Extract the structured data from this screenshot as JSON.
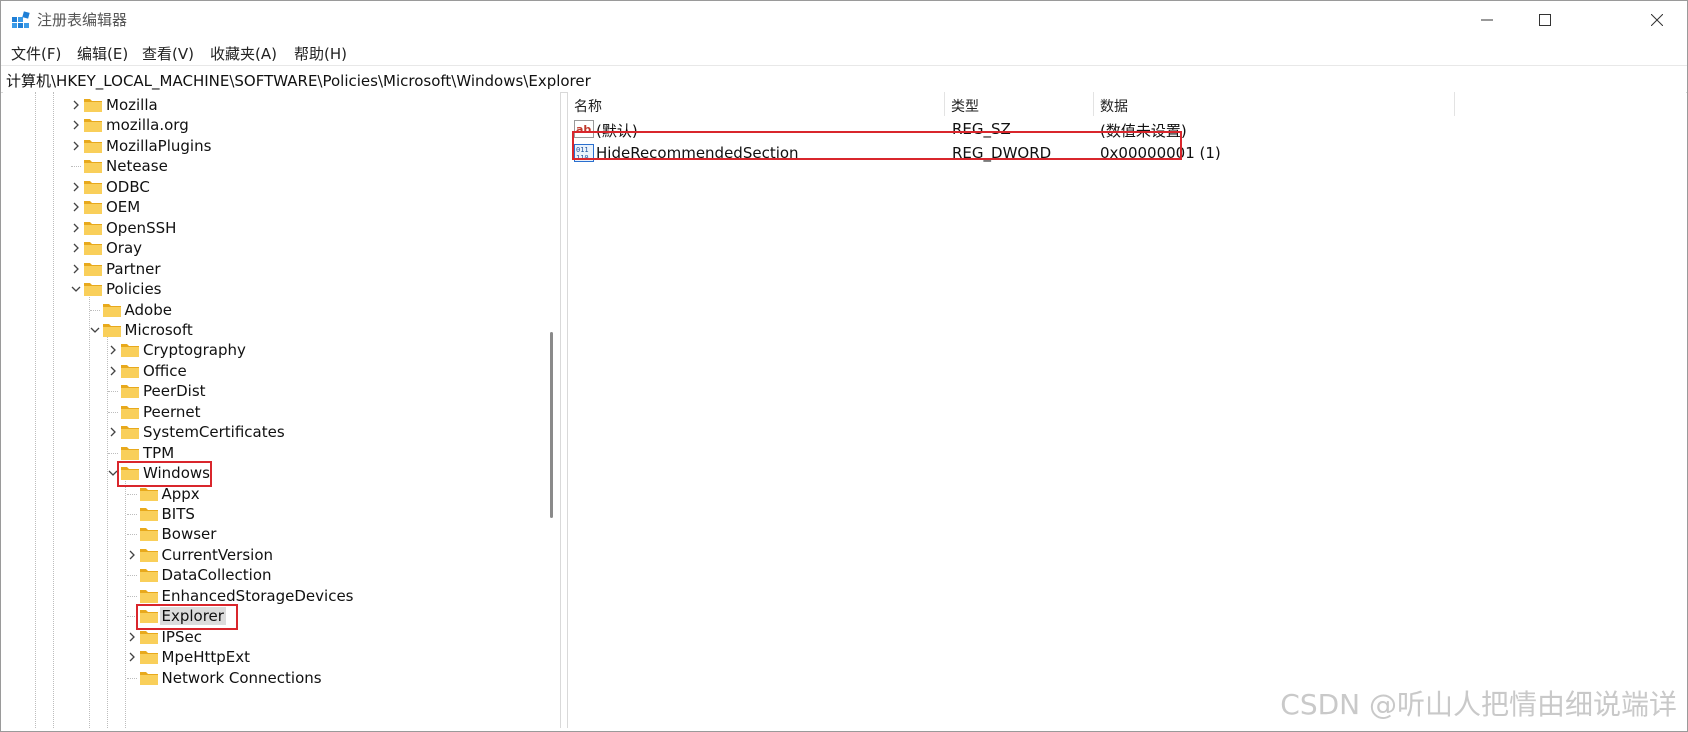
{
  "window": {
    "title": "注册表编辑器",
    "controls": {
      "minimize": "minimize",
      "maximize": "maximize",
      "close": "close"
    }
  },
  "menu": [
    "文件(F)",
    "编辑(E)",
    "查看(V)",
    "收藏夹(A)",
    "帮助(H)"
  ],
  "address": "计算机\\HKEY_LOCAL_MACHINE\\SOFTWARE\\Policies\\Microsoft\\Windows\\Explorer",
  "tree": [
    {
      "label": "Mozilla",
      "expander": "collapsed"
    },
    {
      "label": "mozilla.org",
      "expander": "collapsed"
    },
    {
      "label": "MozillaPlugins",
      "expander": "collapsed"
    },
    {
      "label": "Netease",
      "expander": "none"
    },
    {
      "label": "ODBC",
      "expander": "collapsed"
    },
    {
      "label": "OEM",
      "expander": "collapsed"
    },
    {
      "label": "OpenSSH",
      "expander": "collapsed"
    },
    {
      "label": "Oray",
      "expander": "collapsed"
    },
    {
      "label": "Partner",
      "expander": "collapsed"
    },
    {
      "label": "Policies",
      "expander": "expanded"
    },
    {
      "label": "Adobe",
      "expander": "none"
    },
    {
      "label": "Microsoft",
      "expander": "expanded"
    },
    {
      "label": "Cryptography",
      "expander": "collapsed"
    },
    {
      "label": "Office",
      "expander": "collapsed"
    },
    {
      "label": "PeerDist",
      "expander": "none"
    },
    {
      "label": "Peernet",
      "expander": "none"
    },
    {
      "label": "SystemCertificates",
      "expander": "collapsed"
    },
    {
      "label": "TPM",
      "expander": "none"
    },
    {
      "label": "Windows",
      "expander": "expanded"
    },
    {
      "label": "Appx",
      "expander": "none"
    },
    {
      "label": "BITS",
      "expander": "none"
    },
    {
      "label": "Bowser",
      "expander": "none"
    },
    {
      "label": "CurrentVersion",
      "expander": "collapsed"
    },
    {
      "label": "DataCollection",
      "expander": "none"
    },
    {
      "label": "EnhancedStorageDevices",
      "expander": "none"
    },
    {
      "label": "Explorer",
      "expander": "none",
      "selected": true
    },
    {
      "label": "IPSec",
      "expander": "collapsed"
    },
    {
      "label": "MpeHttpExt",
      "expander": "collapsed"
    },
    {
      "label": "Network Connections",
      "expander": "none"
    }
  ],
  "list": {
    "columns": [
      "名称",
      "类型",
      "数据"
    ],
    "rows": [
      {
        "icon": "string-value-icon",
        "name": "(默认)",
        "type": "REG_SZ",
        "data": "(数值未设置)"
      },
      {
        "icon": "binary-value-icon",
        "name": "HideRecommendedSection",
        "type": "REG_DWORD",
        "data": "0x00000001 (1)"
      }
    ]
  },
  "watermark": "CSDN @听山人把情由细说端详",
  "colors": {
    "highlight_box": "#d9262c",
    "folder": "#f6c54a",
    "selection": "#dcdcdc"
  }
}
